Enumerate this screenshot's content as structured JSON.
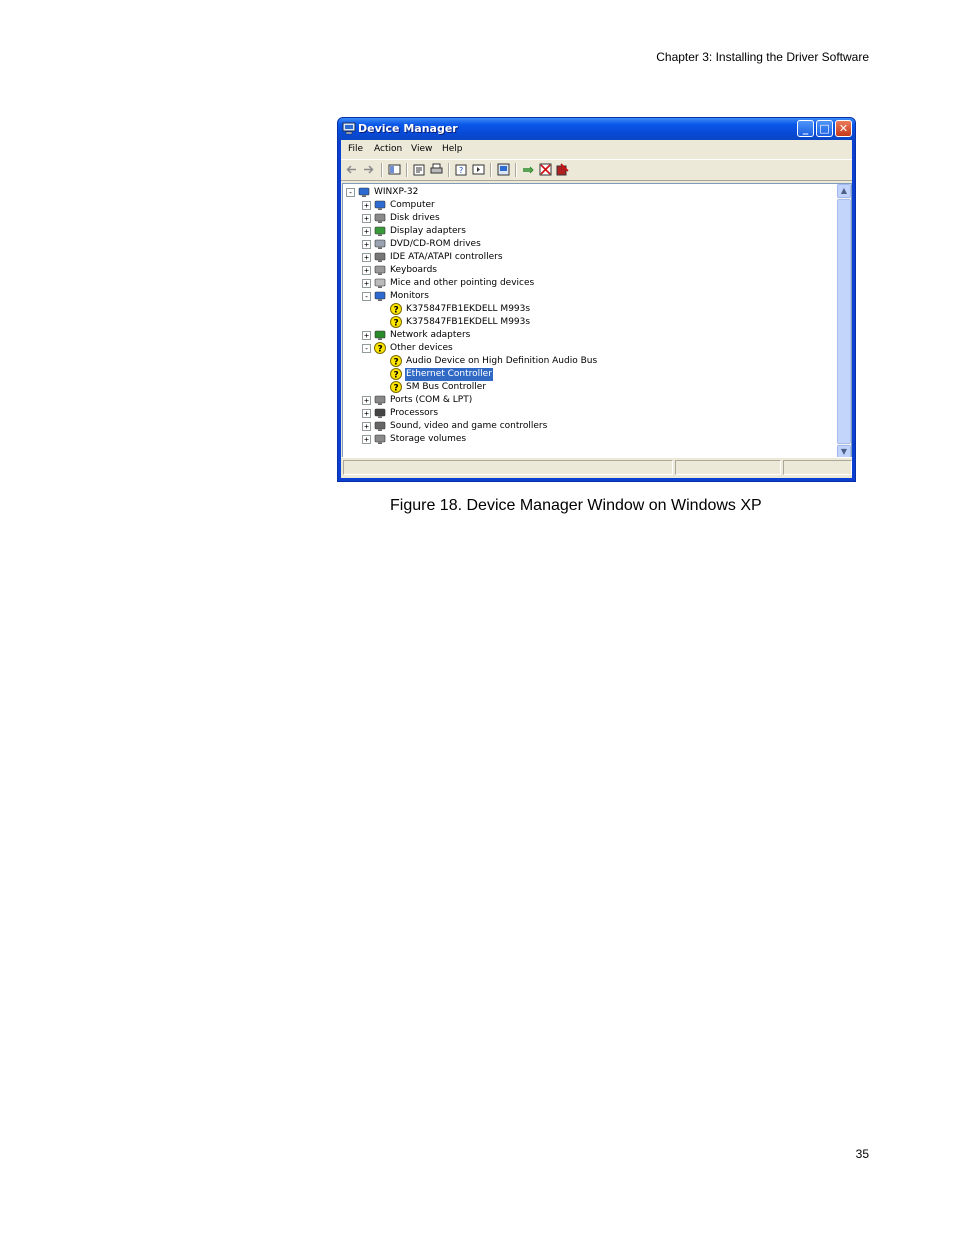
{
  "header": {
    "running_title": "Chapter 3: Installing the Driver Software"
  },
  "figure": {
    "caption": "Figure 18. Device Manager Window on Windows XP"
  },
  "footer": {
    "page_number": "35"
  },
  "window": {
    "title": "Device Manager",
    "menu": [
      "File",
      "Action",
      "View",
      "Help"
    ],
    "controls": {
      "minimize": "_",
      "maximize": "□",
      "close": "✕"
    },
    "tree": {
      "root": "WINXP-32",
      "items": [
        {
          "label": "Computer",
          "icon": "computer-icon",
          "expander": "+",
          "level": 1
        },
        {
          "label": "Disk drives",
          "icon": "disk-drive-icon",
          "expander": "+",
          "level": 1
        },
        {
          "label": "Display adapters",
          "icon": "display-adapter-icon",
          "expander": "+",
          "level": 1
        },
        {
          "label": "DVD/CD-ROM drives",
          "icon": "dvd-drive-icon",
          "expander": "+",
          "level": 1
        },
        {
          "label": "IDE ATA/ATAPI controllers",
          "icon": "ide-controller-icon",
          "expander": "+",
          "level": 1
        },
        {
          "label": "Keyboards",
          "icon": "keyboard-icon",
          "expander": "+",
          "level": 1
        },
        {
          "label": "Mice and other pointing devices",
          "icon": "mouse-icon",
          "expander": "+",
          "level": 1
        },
        {
          "label": "Monitors",
          "icon": "monitor-icon",
          "expander": "-",
          "level": 1
        },
        {
          "label": "K375847FB1EKDELL M993s",
          "icon": "monitor-warning-icon",
          "level": 2
        },
        {
          "label": "K375847FB1EKDELL M993s",
          "icon": "monitor-warning-icon",
          "level": 2
        },
        {
          "label": "Network adapters",
          "icon": "network-adapter-icon",
          "expander": "+",
          "level": 1
        },
        {
          "label": "Other devices",
          "icon": "unknown-device-icon",
          "expander": "-",
          "level": 1
        },
        {
          "label": "Audio Device on High Definition Audio Bus",
          "icon": "unknown-device-warning-icon",
          "level": 2
        },
        {
          "label": "Ethernet Controller",
          "icon": "unknown-device-warning-icon",
          "level": 2,
          "selected": true
        },
        {
          "label": "SM Bus Controller",
          "icon": "unknown-device-warning-icon",
          "level": 2
        },
        {
          "label": "Ports (COM & LPT)",
          "icon": "port-icon",
          "expander": "+",
          "level": 1
        },
        {
          "label": "Processors",
          "icon": "processor-icon",
          "expander": "+",
          "level": 1
        },
        {
          "label": "Sound, video and game controllers",
          "icon": "sound-icon",
          "expander": "+",
          "level": 1
        },
        {
          "label": "Storage volumes",
          "icon": "storage-volume-icon",
          "expander": "+",
          "level": 1
        }
      ]
    },
    "colors": {
      "title_bar": "#0a57e8",
      "selection": "#316ac5",
      "warning": "#ffe600"
    }
  }
}
